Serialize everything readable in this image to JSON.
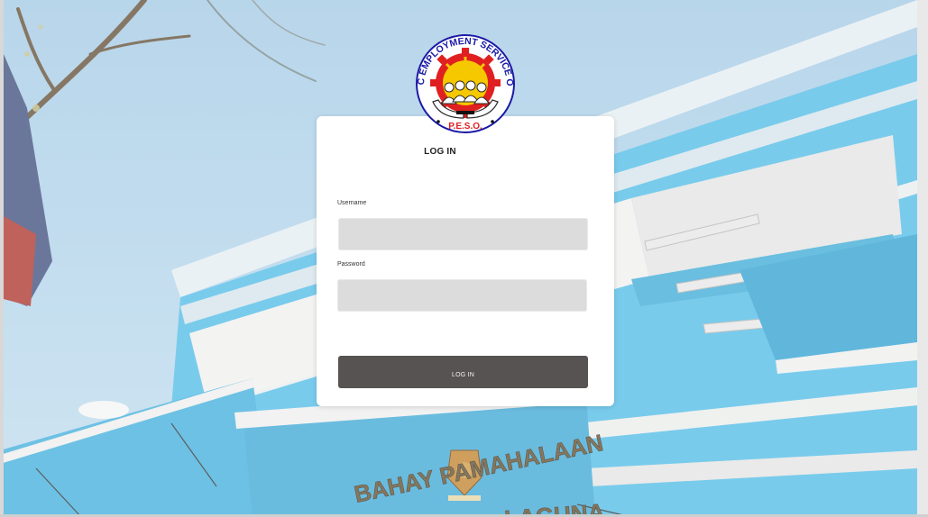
{
  "background": {
    "sign_text": "BAHAY PAMAHALAAN",
    "sign_text_lower": "LAGUNA",
    "sky_color": "#a9cde6",
    "building_color": "#5cc0e8"
  },
  "logo": {
    "ring_text": "PUBLIC EMPLOYMENT SERVICE OFFICE",
    "acronym": "P.E.S.O.",
    "ring_color": "#1a1aa6",
    "gear_color": "#e02020",
    "sun_color": "#f5c800"
  },
  "login_form": {
    "title": "LOG IN",
    "username_label": "Username",
    "username_value": "",
    "password_label": "Password",
    "password_value": "",
    "submit_label": "LOG IN"
  }
}
